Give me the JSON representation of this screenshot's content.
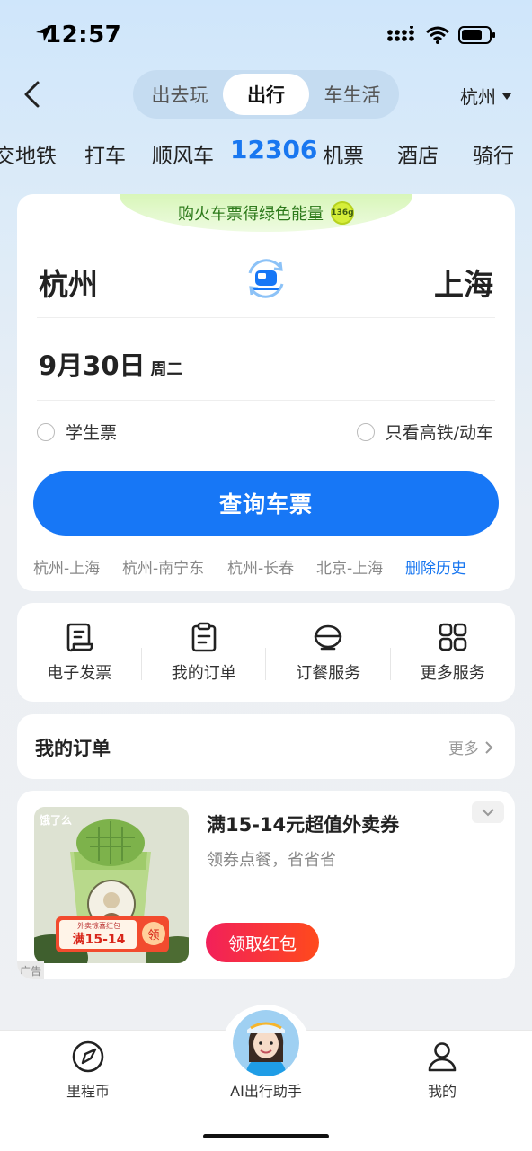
{
  "status": {
    "time": "12:57"
  },
  "header": {
    "segments": [
      {
        "label": "出去玩",
        "active": false
      },
      {
        "label": "出行",
        "active": true
      },
      {
        "label": "车生活",
        "active": false
      }
    ],
    "city": "杭州"
  },
  "categories": [
    "交地铁",
    "打车",
    "顺风车",
    "12306",
    "机票",
    "酒店",
    "骑行"
  ],
  "active_category": "12306",
  "search": {
    "promo": "购火车票得绿色能量",
    "promo_badge": "136g",
    "from": "杭州",
    "to": "上海",
    "date": "9月30日",
    "weekday": "周二",
    "student_ticket": "学生票",
    "high_speed_only": "只看高铁/动车",
    "query_button": "查询车票",
    "history": [
      "杭州-上海",
      "杭州-南宁东",
      "杭州-长春",
      "北京-上海"
    ],
    "delete_history": "删除历史"
  },
  "services": [
    {
      "label": "电子发票",
      "icon": "invoice-icon"
    },
    {
      "label": "我的订单",
      "icon": "clipboard-icon"
    },
    {
      "label": "订餐服务",
      "icon": "meal-bowl-icon"
    },
    {
      "label": "更多服务",
      "icon": "grid-icon"
    }
  ],
  "orders": {
    "title": "我的订单",
    "more": "更多"
  },
  "ad": {
    "title": "满15-14元超值外卖券",
    "subtitle": "领券点餐，省省省",
    "button": "领取红包",
    "tag": "广告",
    "brand": "饿了么",
    "coupon_caption": "外卖惊喜红包",
    "coupon_text": "满15-14",
    "coupon_claim": "领"
  },
  "tabbar": {
    "items": [
      {
        "label": "里程币",
        "icon": "compass-icon"
      },
      {
        "label": "AI出行助手",
        "icon": "ai-avatar"
      },
      {
        "label": "我的",
        "icon": "person-icon"
      }
    ]
  },
  "colors": {
    "accent": "#1777f6",
    "ad_button": "#f2205a",
    "promo_green": "#2d7a1b"
  }
}
